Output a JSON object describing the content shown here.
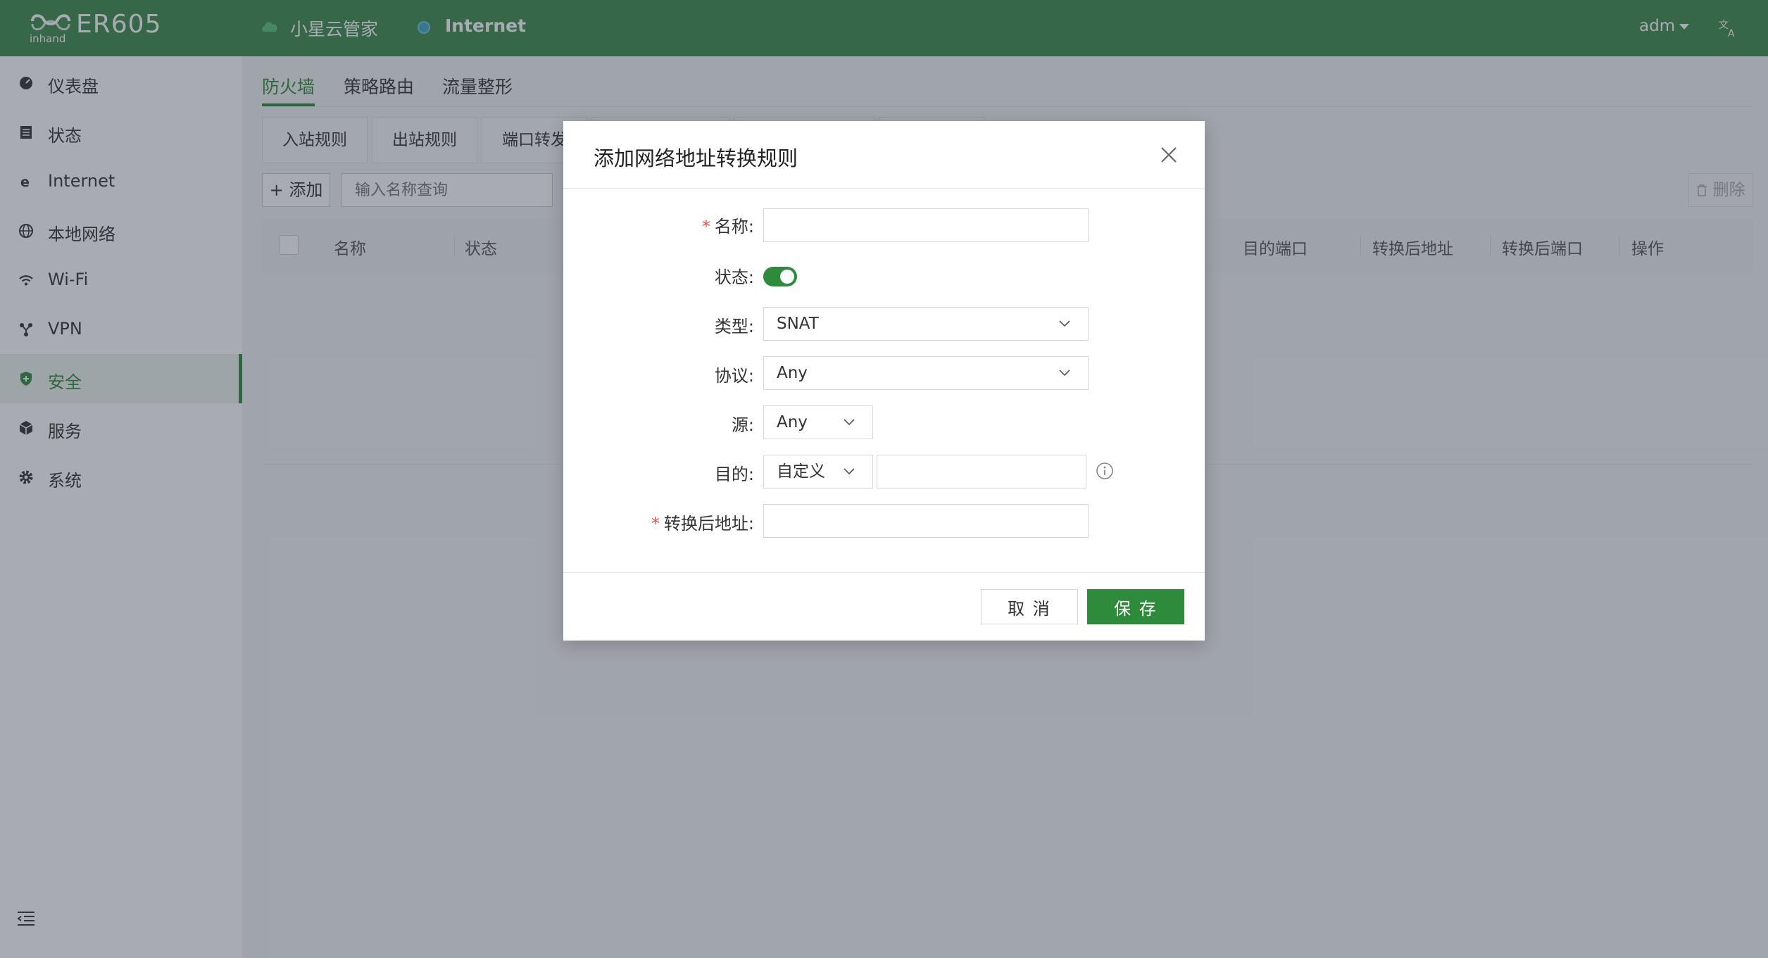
{
  "header": {
    "brand": "ER605",
    "cloud_label": "小星云管家",
    "internet_label": "Internet",
    "user": "adm"
  },
  "sidebar": {
    "items": [
      {
        "label": "仪表盘",
        "icon": "dashboard-icon"
      },
      {
        "label": "状态",
        "icon": "status-icon"
      },
      {
        "label": "Internet",
        "icon": "internet-icon"
      },
      {
        "label": "本地网络",
        "icon": "globe-icon"
      },
      {
        "label": "Wi-Fi",
        "icon": "wifi-icon"
      },
      {
        "label": "VPN",
        "icon": "vpn-icon"
      },
      {
        "label": "安全",
        "icon": "shield-icon",
        "active": true
      },
      {
        "label": "服务",
        "icon": "cube-icon"
      },
      {
        "label": "系统",
        "icon": "gear-icon"
      }
    ]
  },
  "main": {
    "tabs": [
      "防火墙",
      "策略路由",
      "流量整形"
    ],
    "subtabs": [
      "入站规则",
      "出站规则",
      "端口转发"
    ],
    "toolbar": {
      "add_label": "添加",
      "search_placeholder": "输入名称查询",
      "delete_label": "删除"
    },
    "table_columns": [
      "名称",
      "状态",
      "目的端口",
      "转换后地址",
      "转换后端口",
      "操作"
    ]
  },
  "modal": {
    "title": "添加网络地址转换规则",
    "fields": {
      "name_label": "名称",
      "status_label": "状态",
      "status_on": true,
      "type_label": "类型",
      "type_value": "SNAT",
      "protocol_label": "协议",
      "protocol_value": "Any",
      "source_label": "源",
      "source_value": "Any",
      "dest_label": "目的",
      "dest_value": "自定义",
      "translated_label": "转换后地址"
    },
    "cancel_label": "取 消",
    "save_label": "保 存"
  },
  "colors": {
    "header_bg": "#3b8a4c",
    "accent": "#2e8b3c",
    "required": "#e8504a"
  }
}
